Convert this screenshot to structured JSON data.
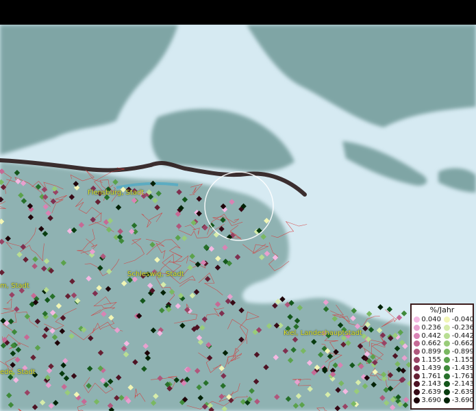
{
  "map": {
    "labels": [
      {
        "id": "flensburg",
        "text": "Flensburg, Stadt"
      },
      {
        "id": "schleswig",
        "text": "Schleswig, Stadt"
      },
      {
        "id": "kiel",
        "text": "Kiel, Landeshauptstadt"
      },
      {
        "id": "husum",
        "text": "m, Stadt"
      },
      {
        "id": "rendsburg",
        "text": "ede, Stadt"
      }
    ]
  },
  "legend": {
    "title": "%/Jahr",
    "positive": [
      {
        "value": "0.040",
        "color": "#f4b8e2"
      },
      {
        "value": "0.236",
        "color": "#e8a0cf"
      },
      {
        "value": "0.442",
        "color": "#d983b4"
      },
      {
        "value": "0.662",
        "color": "#c66a95"
      },
      {
        "value": "0.899",
        "color": "#b0577c"
      },
      {
        "value": "1.155",
        "color": "#994364"
      },
      {
        "value": "1.439",
        "color": "#7f3050"
      },
      {
        "value": "1.761",
        "color": "#662033"
      },
      {
        "value": "2.143",
        "color": "#4e1324"
      },
      {
        "value": "2.639",
        "color": "#370a16"
      },
      {
        "value": "3.690",
        "color": "#1e0409"
      }
    ],
    "negative": [
      {
        "value": "-0.040",
        "color": "#f2f6b6"
      },
      {
        "value": "-0.236",
        "color": "#d6ecaa"
      },
      {
        "value": "-0.442",
        "color": "#b8de93"
      },
      {
        "value": "-0.662",
        "color": "#99cc7a"
      },
      {
        "value": "-0.899",
        "color": "#7ab862"
      },
      {
        "value": "-1.155",
        "color": "#5ba24c"
      },
      {
        "value": "-1.439",
        "color": "#3f8a3a"
      },
      {
        "value": "-1.761",
        "color": "#27702a"
      },
      {
        "value": "-2.143",
        "color": "#14561b"
      },
      {
        "value": "-2.639",
        "color": "#083c0f"
      },
      {
        "value": "-3.690",
        "color": "#022206"
      }
    ]
  }
}
